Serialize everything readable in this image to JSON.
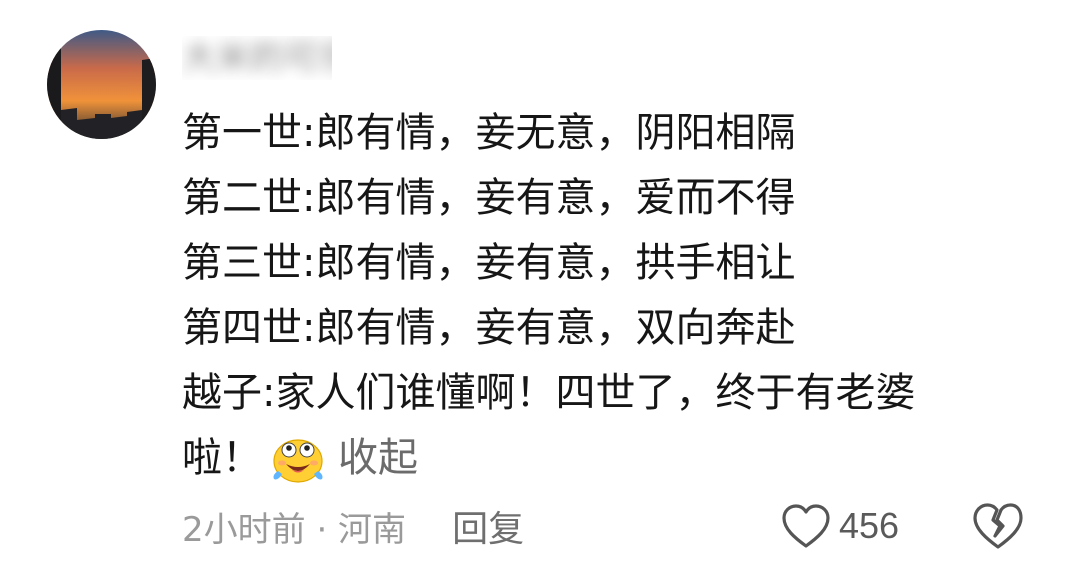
{
  "comment": {
    "username": "大米的可乐",
    "lines": [
      "第一世:郎有情，妾无意，阴阳相隔",
      "第二世:郎有情，妾有意，爱而不得",
      "第三世:郎有情，妾有意，拱手相让",
      "第四世:郎有情，妾有意，双向奔赴",
      "越子:家人们谁懂啊！四世了，终于有老婆"
    ],
    "last_line": "啦！",
    "emoji_icon": "laughing-tears-emoji-icon",
    "collapse_label": "收起",
    "time_location": "2小时前 · 河南",
    "reply_label": "回复",
    "like_count": "456",
    "like_icon": "heart-outline-icon",
    "dislike_icon": "broken-heart-icon"
  },
  "colors": {
    "text": "#161616",
    "muted": "#9a9a9a",
    "link": "#6b6b6b",
    "icon": "#555555"
  }
}
